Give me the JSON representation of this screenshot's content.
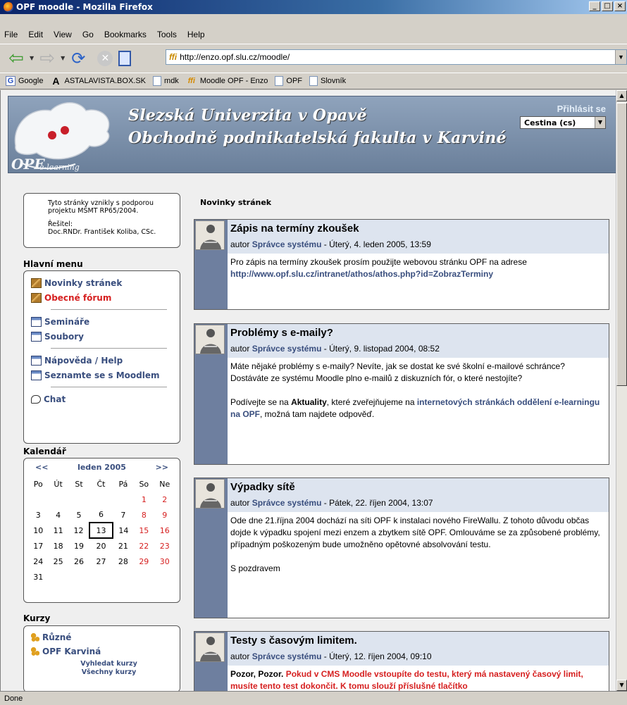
{
  "window": {
    "title": "OPF moodle - Mozilla Firefox",
    "buttons": [
      "_",
      "□",
      "×"
    ]
  },
  "menu": [
    "File",
    "Edit",
    "View",
    "Go",
    "Bookmarks",
    "Tools",
    "Help"
  ],
  "address": {
    "url": "http://enzo.opf.slu.cz/moodle/",
    "favicon": "ffi"
  },
  "bookmarks": [
    {
      "label": "Google",
      "icon": "google-icon",
      "glyph": "G"
    },
    {
      "label": "ASTALAVISTA.BOX.SK",
      "icon": "astalavista-icon",
      "glyph": "A"
    },
    {
      "label": "mdk",
      "icon": "folder-icon",
      "glyph": ""
    },
    {
      "label": "Moodle OPF - Enzo",
      "icon": "moodle-icon",
      "glyph": "ffi"
    },
    {
      "label": "OPF",
      "icon": "folder-icon",
      "glyph": ""
    },
    {
      "label": "Slovník",
      "icon": "folder-icon",
      "glyph": ""
    }
  ],
  "status": "Done",
  "header": {
    "line1": "Slezská Univerzita v Opavě",
    "line2": "Obchodně podnikatelská fakulta v Karviné",
    "logo_text": "OPF e-learning",
    "login": "Přihlásit se",
    "language": "Cestina (cs)"
  },
  "info": {
    "line1": "Tyto stránky vznikly s podporou projektu MŠMT RP65/2004.",
    "line2": "Řešitel:",
    "line3": "Doc.RNDr. František Koliba, CSc."
  },
  "main_menu": {
    "heading": "Hlavní menu",
    "group1": [
      "Novinky stránek",
      "Obecné fórum"
    ],
    "group2": [
      "Semináře",
      "Soubory"
    ],
    "group3": [
      "Nápověda / Help",
      "Seznamte se s Moodlem"
    ],
    "group4": [
      "Chat"
    ]
  },
  "calendar": {
    "heading": "Kalendář",
    "prev": "<<",
    "next": ">>",
    "month": "leden 2005",
    "weekdays": [
      "Po",
      "Út",
      "St",
      "Čt",
      "Pá",
      "So",
      "Ne"
    ],
    "weeks": [
      [
        "",
        "",
        "",
        "",
        "",
        "1",
        "2"
      ],
      [
        "3",
        "4",
        "5",
        "6",
        "7",
        "8",
        "9"
      ],
      [
        "10",
        "11",
        "12",
        "13",
        "14",
        "15",
        "16"
      ],
      [
        "17",
        "18",
        "19",
        "20",
        "21",
        "22",
        "23"
      ],
      [
        "24",
        "25",
        "26",
        "27",
        "28",
        "29",
        "30"
      ],
      [
        "31",
        "",
        "",
        "",
        "",
        "",
        ""
      ]
    ],
    "today": "13",
    "weekend_color": "#d62020"
  },
  "courses": {
    "heading": "Kurzy",
    "items": [
      "Různé",
      "OPF Karviná"
    ],
    "search": "Vyhledat kurzy",
    "all": "Všechny kurzy"
  },
  "news": {
    "heading": "Novinky stránek",
    "author_prefix": "autor",
    "author_name": "Správce systému",
    "posts": [
      {
        "title": "Zápis na termíny zkoušek",
        "date": "Úterý, 4. leden 2005, 13:59",
        "text1": "Pro zápis na termíny zkoušek prosím použijte webovou stránku OPF na adrese",
        "link": "http://www.opf.slu.cz/intranet/athos/athos.php?id=ZobrazTerminy"
      },
      {
        "title": "Problémy s e-maily?",
        "date": "Úterý, 9. listopad 2004, 08:52",
        "text1": "Máte nějaké problémy s e-maily? Nevíte, jak se dostat ke své školní e-mailové schránce? Dostáváte ze systému Moodle plno e-mailů z diskuzních fór, o které nestojíte?",
        "text2a": "Podívejte se na",
        "text2b": "Aktuality",
        "text2c": ", které zveřejňujeme na",
        "text2link": "internetových stránkách oddělení e-learningu na OPF",
        "text2d": ", možná tam najdete odpověď."
      },
      {
        "title": "Výpadky sítě",
        "date": "Pátek, 22. říjen 2004, 13:07",
        "text1": "Ode dne 21.října 2004 dochází na síti OPF k instalaci nového FireWallu. Z tohoto důvodu občas dojde k výpadku spojení mezi enzem a zbytkem sítě OPF. Omlouváme se za způsobené problémy, případným poškozeným bude umožněno opětovné absolvování testu.",
        "text2": "S pozdravem"
      },
      {
        "title": "Testy s časovým limitem.",
        "date": "Úterý, 12. říjen 2004, 09:10",
        "text1a": "Pozor, Pozor.",
        "text1b": "Pokud v CMS Moodle vstoupíte do testu, který má nastavený časový limit, musíte tento test dokončit. K tomu slouží příslušné tlačítko"
      }
    ]
  }
}
